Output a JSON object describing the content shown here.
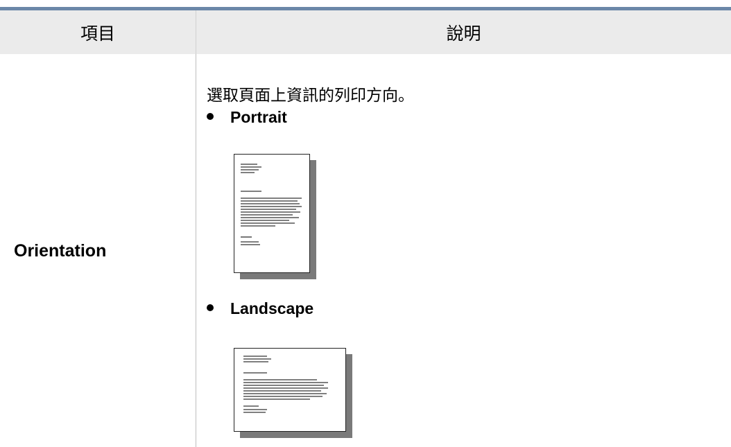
{
  "table": {
    "header": {
      "item": "項目",
      "description": "說明"
    },
    "rows": [
      {
        "item": "Orientation",
        "description": "選取頁面上資訊的列印方向。",
        "options": [
          {
            "label": "Portrait",
            "icon": "portrait-page-icon"
          },
          {
            "label": "Landscape",
            "icon": "landscape-page-icon"
          }
        ]
      }
    ]
  },
  "colors": {
    "top_rule": "#6b87a8",
    "header_bg": "#ebebeb",
    "shadow": "#7a7a7a"
  }
}
